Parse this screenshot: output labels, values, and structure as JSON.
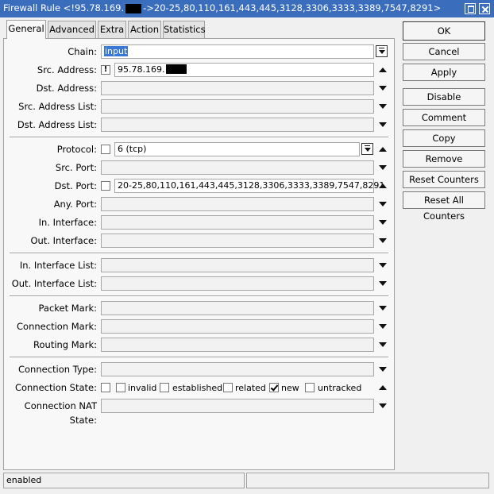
{
  "window": {
    "title_prefix": "Firewall Rule <!95.78.169.",
    "title_suffix": "->20-25,80,110,161,443,445,3128,3306,3333,3389,7547,8291>"
  },
  "tabs": [
    "General",
    "Advanced",
    "Extra",
    "Action",
    "Statistics"
  ],
  "fields": {
    "chain": {
      "label": "Chain:",
      "value": "input"
    },
    "src_address": {
      "label": "Src. Address:",
      "negate": "!",
      "value": "95.78.169."
    },
    "dst_address": {
      "label": "Dst. Address:"
    },
    "src_address_list": {
      "label": "Src. Address List:"
    },
    "dst_address_list": {
      "label": "Dst. Address List:"
    },
    "protocol": {
      "label": "Protocol:",
      "value": "6 (tcp)"
    },
    "src_port": {
      "label": "Src. Port:"
    },
    "dst_port": {
      "label": "Dst. Port:",
      "value": "20-25,80,110,161,443,445,3128,3306,3333,3389,7547,8291"
    },
    "any_port": {
      "label": "Any. Port:"
    },
    "in_interface": {
      "label": "In. Interface:"
    },
    "out_interface": {
      "label": "Out. Interface:"
    },
    "in_interface_list": {
      "label": "In. Interface List:"
    },
    "out_interface_list": {
      "label": "Out. Interface List:"
    },
    "packet_mark": {
      "label": "Packet Mark:"
    },
    "connection_mark": {
      "label": "Connection Mark:"
    },
    "routing_mark": {
      "label": "Routing Mark:"
    },
    "connection_type": {
      "label": "Connection Type:"
    },
    "connection_state": {
      "label": "Connection State:",
      "options": [
        {
          "label": "invalid",
          "checked": false
        },
        {
          "label": "established",
          "checked": false
        },
        {
          "label": "related",
          "checked": false
        },
        {
          "label": "new",
          "checked": true
        },
        {
          "label": "untracked",
          "checked": false
        }
      ]
    },
    "connection_nat_state": {
      "label": "Connection NAT State:"
    }
  },
  "buttons": [
    "OK",
    "Cancel",
    "Apply",
    "Disable",
    "Comment",
    "Copy",
    "Remove",
    "Reset Counters",
    "Reset All Counters"
  ],
  "status": {
    "left": "enabled",
    "right": ""
  }
}
